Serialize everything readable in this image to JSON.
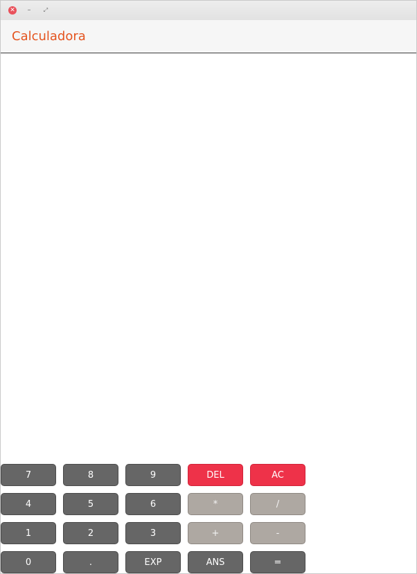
{
  "window": {
    "title": "Calculadora",
    "controls": {
      "close": "✕",
      "minimize": "–",
      "maximize": "⤢"
    }
  },
  "display": {
    "value": ""
  },
  "keypad": {
    "rows": [
      [
        {
          "label": "7",
          "style": "num"
        },
        {
          "label": "8",
          "style": "num"
        },
        {
          "label": "9",
          "style": "num"
        },
        {
          "label": "DEL",
          "style": "red"
        },
        {
          "label": "AC",
          "style": "red"
        }
      ],
      [
        {
          "label": "4",
          "style": "num"
        },
        {
          "label": "5",
          "style": "num"
        },
        {
          "label": "6",
          "style": "num"
        },
        {
          "label": "*",
          "style": "op"
        },
        {
          "label": "/",
          "style": "op"
        }
      ],
      [
        {
          "label": "1",
          "style": "num"
        },
        {
          "label": "2",
          "style": "num"
        },
        {
          "label": "3",
          "style": "num"
        },
        {
          "label": "+",
          "style": "op"
        },
        {
          "label": "-",
          "style": "op"
        }
      ],
      [
        {
          "label": "0",
          "style": "num"
        },
        {
          "label": ".",
          "style": "num"
        },
        {
          "label": "EXP",
          "style": "num"
        },
        {
          "label": "ANS",
          "style": "num"
        },
        {
          "label": "=",
          "style": "num"
        }
      ]
    ]
  },
  "colors": {
    "title": "#e4541f",
    "number_key": "#666666",
    "danger_key": "#ee3249",
    "operator_key": "#aea8a2"
  }
}
